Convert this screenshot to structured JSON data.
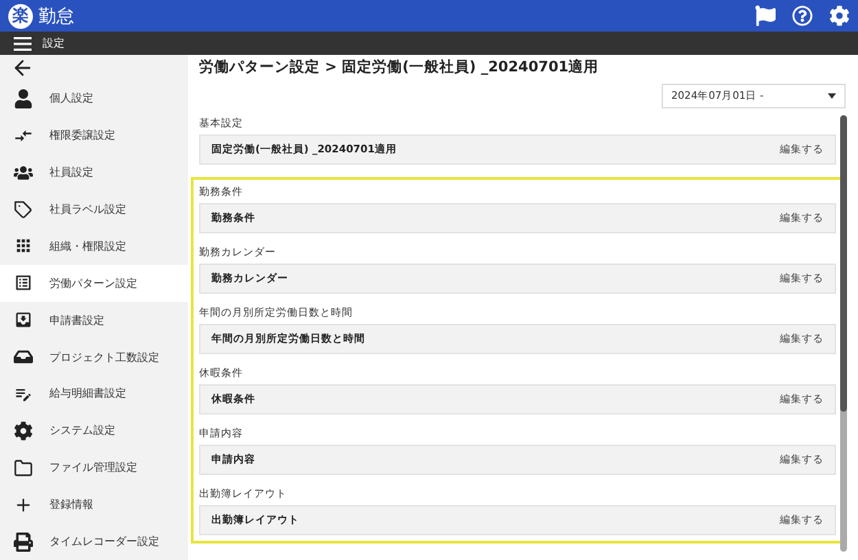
{
  "header": {
    "logo_mark": "楽",
    "logo_text": "勤怠"
  },
  "subbar": {
    "title": "設定"
  },
  "sidebar": {
    "items": [
      {
        "label": "個人設定",
        "selected": false
      },
      {
        "label": "権限委譲設定",
        "selected": false
      },
      {
        "label": "社員設定",
        "selected": false
      },
      {
        "label": "社員ラベル設定",
        "selected": false
      },
      {
        "label": "組織・権限設定",
        "selected": false
      },
      {
        "label": "労働パターン設定",
        "selected": true
      },
      {
        "label": "申請書設定",
        "selected": false
      },
      {
        "label": "プロジェクト工数設定",
        "selected": false
      },
      {
        "label": "給与明細書設定",
        "selected": false
      },
      {
        "label": "システム設定",
        "selected": false
      },
      {
        "label": "ファイル管理設定",
        "selected": false
      },
      {
        "label": "登録情報",
        "selected": false
      },
      {
        "label": "タイムレコーダー設定",
        "selected": false
      }
    ]
  },
  "page": {
    "title": "労働パターン設定 > 固定労働(一般社員) _20240701適用",
    "date_select": {
      "value": "2024年07月01日 -"
    }
  },
  "sections": [
    {
      "heading": "基本設定",
      "value": "固定労働(一般社員) _20240701適用",
      "action": "編集する"
    }
  ],
  "highlighted_sections": [
    {
      "heading": "勤務条件",
      "value": "勤務条件",
      "action": "編集する"
    },
    {
      "heading": "勤務カレンダー",
      "value": "勤務カレンダー",
      "action": "編集する"
    },
    {
      "heading": "年間の月別所定労働日数と時間",
      "value": "年間の月別所定労働日数と時間",
      "action": "編集する"
    },
    {
      "heading": "休暇条件",
      "value": "休暇条件",
      "action": "編集する"
    },
    {
      "heading": "申請内容",
      "value": "申請内容",
      "action": "編集する"
    },
    {
      "heading": "出勤簿レイアウト",
      "value": "出勤簿レイアウト",
      "action": "編集する"
    }
  ]
}
